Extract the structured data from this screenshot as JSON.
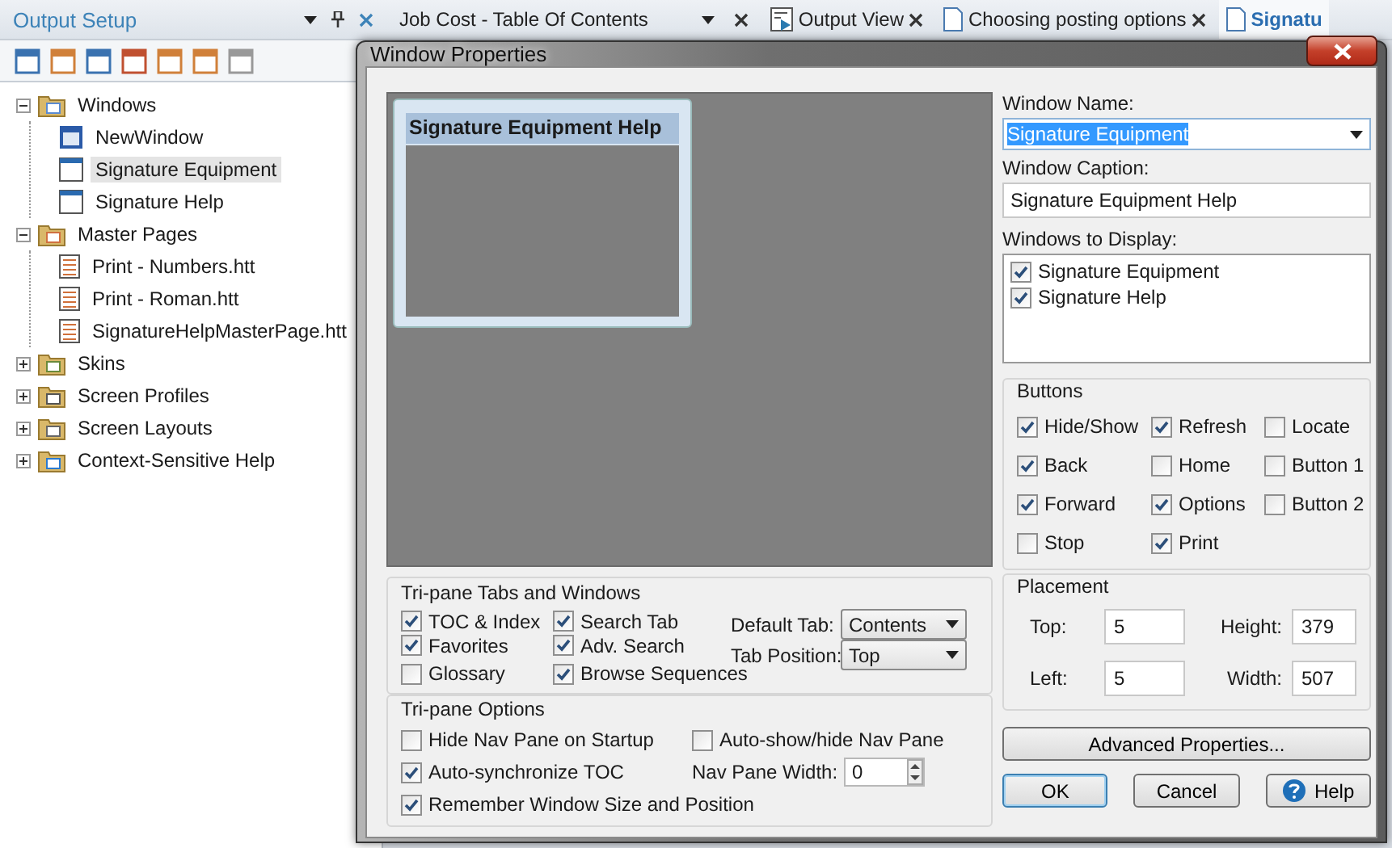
{
  "panel": {
    "title": "Output Setup"
  },
  "tree": [
    {
      "label": "Windows",
      "kind": "folder-window",
      "expanded": true,
      "children": [
        {
          "label": "NewWindow",
          "kind": "new-window",
          "selected": false
        },
        {
          "label": "Signature Equipment",
          "kind": "window",
          "selected": true
        },
        {
          "label": "Signature Help",
          "kind": "window",
          "selected": false
        }
      ]
    },
    {
      "label": "Master Pages",
      "kind": "folder-page",
      "expanded": true,
      "children": [
        {
          "label": "Print - Numbers.htt",
          "kind": "page",
          "selected": false
        },
        {
          "label": "Print - Roman.htt",
          "kind": "page",
          "selected": false
        },
        {
          "label": "SignatureHelpMasterPage.htt",
          "kind": "page",
          "selected": false
        }
      ]
    },
    {
      "label": "Skins",
      "kind": "folder-skin",
      "expanded": false
    },
    {
      "label": "Screen Profiles",
      "kind": "folder-profile",
      "expanded": false
    },
    {
      "label": "Screen Layouts",
      "kind": "folder-layout",
      "expanded": false
    },
    {
      "label": "Context-Sensitive Help",
      "kind": "folder-csh",
      "expanded": false
    }
  ],
  "doc_tabs": [
    {
      "label": "Job Cost - Table Of Contents",
      "kind": "pane",
      "selected": false
    },
    {
      "label": "Output View",
      "kind": "output",
      "selected": false
    },
    {
      "label": "Choosing posting options",
      "kind": "doc",
      "selected": false
    },
    {
      "label": "Signatu",
      "kind": "doc",
      "selected": true
    }
  ],
  "dialog": {
    "title": "Window Properties",
    "preview": {
      "caption": "Signature Equipment Help"
    },
    "window_name": {
      "label": "Window Name:",
      "value": "Signature Equipment"
    },
    "window_caption": {
      "label": "Window Caption:",
      "value": "Signature Equipment Help"
    },
    "windows_to_display": {
      "label": "Windows to Display:",
      "items": [
        {
          "label": "Signature Equipment",
          "checked": true
        },
        {
          "label": "Signature Help",
          "checked": true
        }
      ]
    },
    "buttons_group": {
      "title": "Buttons",
      "items": [
        {
          "label": "Hide/Show",
          "checked": true
        },
        {
          "label": "Refresh",
          "checked": true
        },
        {
          "label": "Locate",
          "checked": false
        },
        {
          "label": "Back",
          "checked": true
        },
        {
          "label": "Home",
          "checked": false
        },
        {
          "label": "Button 1",
          "checked": false
        },
        {
          "label": "Forward",
          "checked": true
        },
        {
          "label": "Options",
          "checked": true
        },
        {
          "label": "Button 2",
          "checked": false
        },
        {
          "label": "Stop",
          "checked": false
        },
        {
          "label": "Print",
          "checked": true
        }
      ]
    },
    "placement": {
      "title": "Placement",
      "fields": [
        {
          "label": "Top:",
          "value": "5"
        },
        {
          "label": "Height:",
          "value": "379"
        },
        {
          "label": "Left:",
          "value": "5"
        },
        {
          "label": "Width:",
          "value": "507"
        }
      ]
    },
    "tripane_tabs": {
      "title": "Tri-pane Tabs and Windows",
      "items": [
        {
          "label": "TOC & Index",
          "checked": true
        },
        {
          "label": "Favorites",
          "checked": true
        },
        {
          "label": "Glossary",
          "checked": false
        },
        {
          "label": "Search Tab",
          "checked": true
        },
        {
          "label": "Adv. Search",
          "checked": true
        },
        {
          "label": "Browse Sequences",
          "checked": true
        }
      ],
      "selects": [
        {
          "label": "Default Tab:",
          "value": "Contents"
        },
        {
          "label": "Tab Position:",
          "value": "Top"
        }
      ]
    },
    "tripane_options": {
      "title": "Tri-pane Options",
      "items": [
        {
          "label": "Hide Nav Pane on Startup",
          "checked": false
        },
        {
          "label": "Auto-show/hide Nav Pane",
          "checked": false
        },
        {
          "label": "Auto-synchronize TOC",
          "checked": true
        },
        {
          "label": "Remember Window Size and Position",
          "checked": true
        }
      ],
      "nav_pane_width": {
        "label": "Nav Pane Width:",
        "value": "0"
      }
    },
    "advanced_button": "Advanced Properties...",
    "footer_buttons": [
      {
        "label": "OK",
        "kind": "default"
      },
      {
        "label": "Cancel",
        "kind": "plain"
      },
      {
        "label": "Help",
        "kind": "help"
      }
    ]
  }
}
